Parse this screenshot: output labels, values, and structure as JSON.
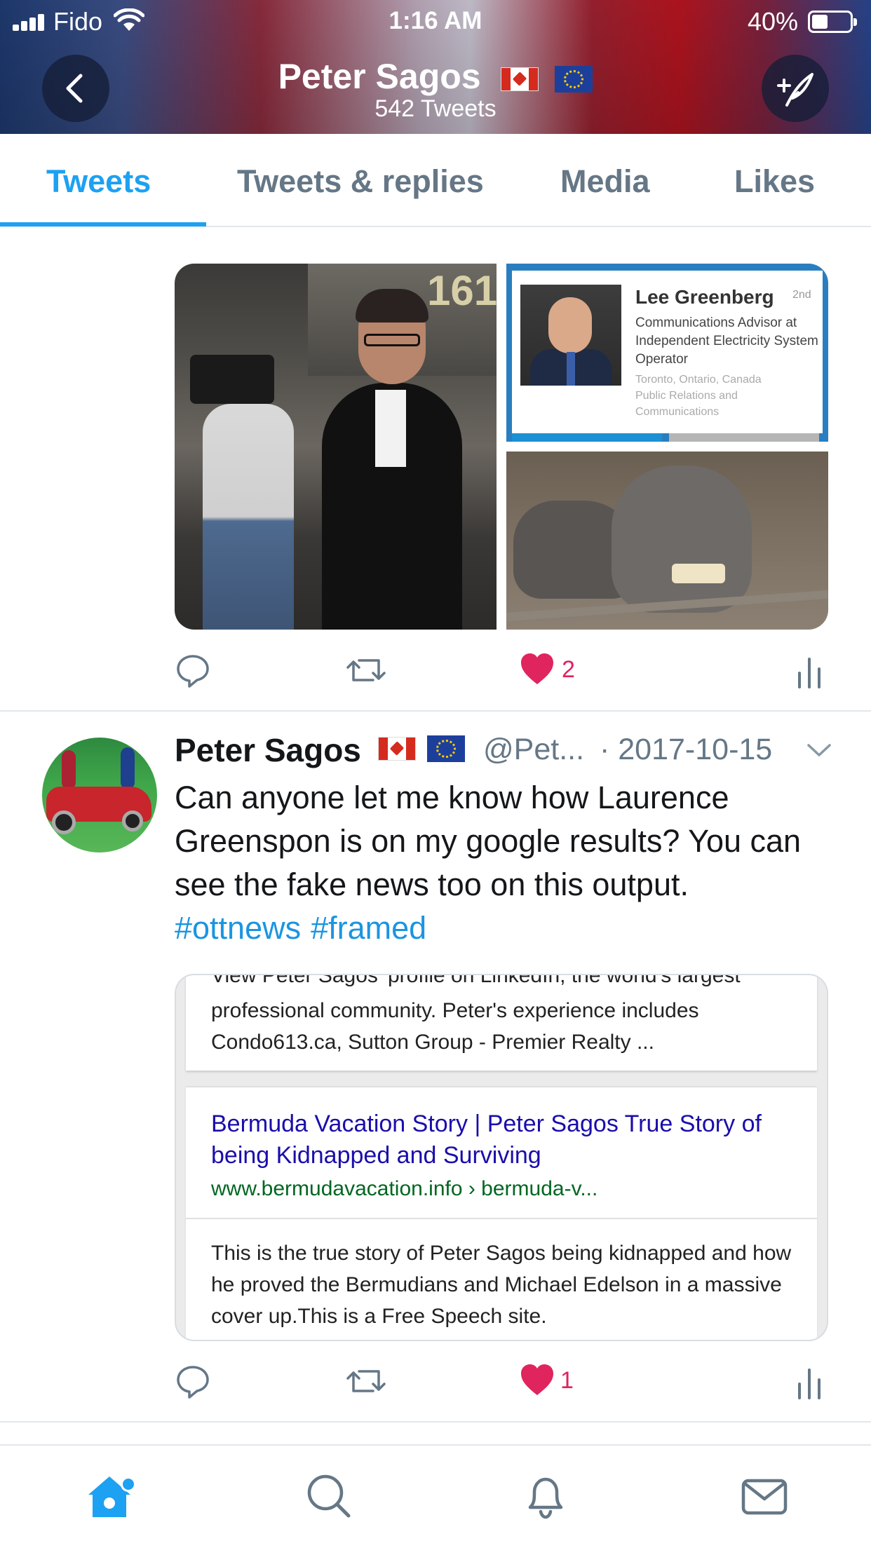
{
  "status_bar": {
    "carrier": "Fido",
    "time": "1:16 AM",
    "battery_percent": "40%",
    "battery_level": 0.4
  },
  "header": {
    "name": "Peter Sagos",
    "tweet_count": "542 Tweets",
    "flags": [
      "canada-flag",
      "eu-flag"
    ]
  },
  "tabs": [
    {
      "label": "Tweets",
      "active": true
    },
    {
      "label": "Tweets & replies",
      "active": false
    },
    {
      "label": "Media",
      "active": false
    },
    {
      "label": "Likes",
      "active": false
    }
  ],
  "tweet1": {
    "linkedin_card": {
      "name": "Lee Greenberg",
      "degree": "2nd",
      "title": "Communications Advisor at Independent Electricity System Operator",
      "location": "Toronto, Ontario, Canada",
      "industry": "Public Relations and Communications"
    },
    "media_number": "161",
    "likes": "2"
  },
  "tweet2": {
    "name": "Peter Sagos",
    "handle": "@Pet...",
    "date": "· 2017-10-15",
    "text": "Can anyone let me know how Laurence Greenspon is on my google results? You can see the fake news too on this output.",
    "hashtags": [
      "#ottnews",
      "#framed"
    ],
    "result_card": {
      "clipped_line": "View Peter Sagos' profile on LinkedIn, the world's largest",
      "snippet1": "professional community. Peter's experience includes Condo613.ca, Sutton Group - Premier Realty  ...",
      "title": "Bermuda Vacation Story | Peter Sagos True Story of being Kidnapped and Surviving",
      "url": "www.bermudavacation.info › bermuda-v...",
      "snippet2": "This is the true story of Peter Sagos being kidnapped and how he proved the Bermudians and Michael Edelson in a massive cover up.This is a Free Speech site."
    },
    "likes": "1"
  },
  "colors": {
    "accent": "#1da1f2",
    "like": "#e0245e",
    "hashtag": "#1b95e0",
    "google_title": "#1a0dab",
    "google_url": "#006621"
  },
  "bottom_nav": [
    "home-icon",
    "search-icon",
    "notifications-icon",
    "messages-icon"
  ]
}
